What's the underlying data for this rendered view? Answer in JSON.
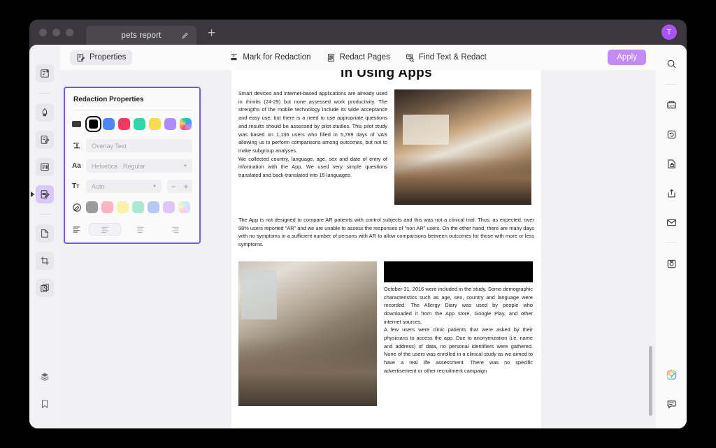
{
  "window": {
    "tab_title": "pets report",
    "new_tab_label": "+",
    "avatar_initial": "T"
  },
  "toolbar": {
    "properties_label": "Properties",
    "mark_for_redaction_label": "Mark for Redaction",
    "redact_pages_label": "Redact Pages",
    "find_text_redact_label": "Find Text & Redact",
    "apply_label": "Apply"
  },
  "redaction_panel": {
    "title": "Redaction Properties",
    "overlay_text_placeholder": "Overlay Text",
    "overlay_text_value": "",
    "font_value": "Helvetica · Regular",
    "font_size_value": "Auto",
    "minus_label": "−",
    "plus_label": "+",
    "fill_colors": [
      "#3b3b3d",
      "#000000",
      "#4f86f7",
      "#f6385f",
      "#2fd6a8",
      "#fada4e",
      "#b08cf8",
      "#rainbow"
    ],
    "outline_colors": [
      "#9a9a9f",
      "#ffb3c1",
      "#fdf0a8",
      "#a9e9d3",
      "#b8c8f5",
      "#dcc6fb",
      "#rainbow-pale"
    ],
    "selected_fill_index": 1,
    "accent_border": "#6c5ce7"
  },
  "left_rail": {
    "items": [
      {
        "name": "bookmarks-panel-icon"
      },
      {
        "name": "highlighter-icon"
      },
      {
        "name": "annotate-icon"
      },
      {
        "name": "form-fields-icon"
      },
      {
        "name": "redact-icon"
      },
      {
        "name": "page-edit-icon"
      },
      {
        "name": "crop-icon"
      },
      {
        "name": "stamp-icon"
      }
    ],
    "bottom_items": [
      {
        "name": "layers-icon"
      },
      {
        "name": "bookmark-icon"
      }
    ]
  },
  "right_rail": {
    "items": [
      {
        "name": "search-icon"
      },
      {
        "name": "ocr-icon"
      },
      {
        "name": "convert-icon"
      },
      {
        "name": "protect-document-icon"
      },
      {
        "name": "share-icon"
      },
      {
        "name": "email-icon"
      },
      {
        "name": "save-icon"
      }
    ],
    "bottom_items": [
      {
        "name": "ai-sparkle-icon"
      },
      {
        "name": "comment-icon"
      }
    ]
  },
  "document": {
    "title": "in Using Apps",
    "col1_paragraphs": [
      "Smart devices and internet-based applications are already used in rhinitis (24-29) but none assessed work productivity. The strengths of the mobile technology include its wide acceptance and easy use, but there is a need to use appropriate questions and results should be assessed by pilot studies. This pilot study was based on 1,136 users who filled in 5,789 days of VAS allowing us to perform comparisons among outcomes, but not to make subgroup analyses.",
      "We collected country, language, age, sex and date of entry of information with the App. We used very simple questions translated and back-translated into 15 languages."
    ],
    "wide_paragraph": "The App is not designed to compare AR patients with control subjects and this was not a clinical trial. Thus, as expected, over 98% users reported \"AR\" and we are unable to assess the responses of \"non AR\" users. On the other hand, there are many days with no symptoms in a sufficient number of persons with AR to allow comparisons between outcomes for those with more or less symptoms.",
    "col2_paragraphs": [
      "October 31, 2016 were included in the study. Some demographic characteristics such as age, sex, country and language were recorded. The Allergy Diary was used by people who downloaded it from the App store, Google Play, and other internet sources.",
      "A few users were clinic patients that were asked by their physicians to access the app. Due to anonymization (i.e. name and address) of data, no personal identifiers were gathered. None of the users was enrolled in a clinical study as we aimed to have a real life assessment. There was no specific advertisement or other recruitment campaign"
    ],
    "redaction_bar_present": true
  }
}
